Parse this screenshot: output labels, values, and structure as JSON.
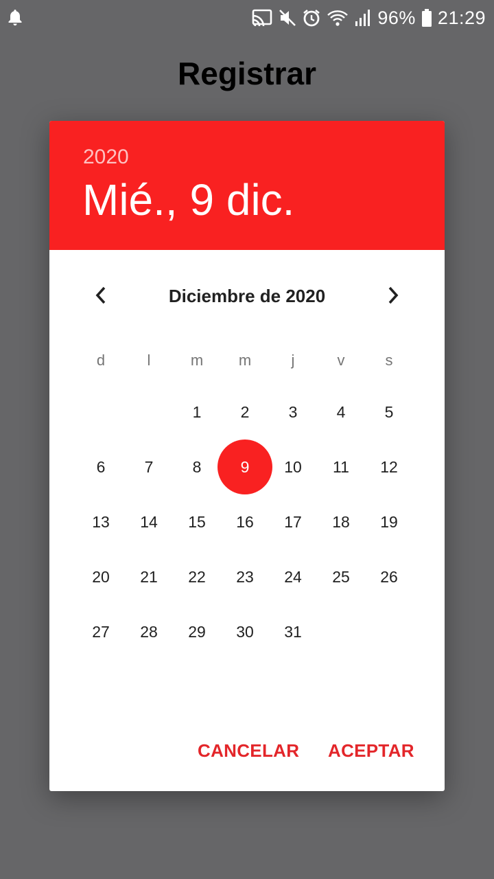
{
  "status_bar": {
    "battery_level": "96%",
    "time": "21:29",
    "icons": [
      "notification-bell-icon",
      "cast-icon",
      "mute-icon",
      "alarm-icon",
      "wifi-icon",
      "signal-icon",
      "battery-icon"
    ]
  },
  "page": {
    "title": "Registrar"
  },
  "colors": {
    "accent": "#f92121",
    "button_text": "#e3262a",
    "backdrop": "#666668"
  },
  "dialog": {
    "header": {
      "year": "2020",
      "date": "Mié., 9 dic."
    },
    "month_label": "Diciembre de 2020",
    "prev_icon": "chevron-left-icon",
    "next_icon": "chevron-right-icon",
    "weekdays": [
      "d",
      "l",
      "m",
      "m",
      "j",
      "v",
      "s"
    ],
    "days": [
      "1",
      "2",
      "3",
      "4",
      "5",
      "6",
      "7",
      "8",
      "9",
      "10",
      "11",
      "12",
      "13",
      "14",
      "15",
      "16",
      "17",
      "18",
      "19",
      "20",
      "21",
      "22",
      "23",
      "24",
      "25",
      "26",
      "27",
      "28",
      "29",
      "30",
      "31"
    ],
    "selected_day": "9",
    "actions": {
      "cancel": "CANCELAR",
      "accept": "ACEPTAR"
    }
  }
}
